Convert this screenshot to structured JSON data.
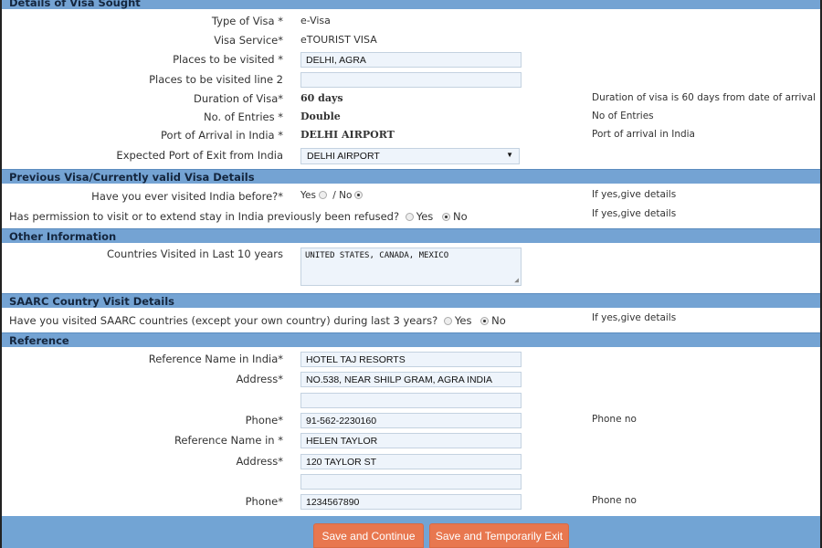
{
  "sections": {
    "visa": "Details of Visa Sought",
    "previous": "Previous Visa/Currently valid Visa Details",
    "other": "Other Information",
    "saarc": "SAARC Country Visit Details",
    "reference": "Reference"
  },
  "visa": {
    "type_label": "Type of Visa *",
    "type_value": "e-Visa",
    "service_label": "Visa Service*",
    "service_value": "eTOURIST VISA",
    "places_label": "Places to be visited *",
    "places_value": "DELHI, AGRA",
    "places2_label": "Places to be visited line 2",
    "places2_value": "",
    "duration_label": "Duration of Visa*",
    "duration_value": "60 days",
    "duration_hint": "Duration of visa is 60 days from date of arrival",
    "entries_label": "No. of Entries *",
    "entries_value": "Double",
    "entries_hint": "No of Entries",
    "arrival_label": "Port of Arrival in India *",
    "arrival_value": "DELHI AIRPORT",
    "arrival_hint": "Port of arrival in India",
    "exit_label": "Expected Port of Exit from India",
    "exit_value": "DELHI AIRPORT"
  },
  "previous": {
    "visited_label": "Have you ever visited India before?*",
    "yes": "Yes",
    "sep": "/ No",
    "visited_selected": "No",
    "visited_hint": "If yes,give details",
    "refused_label": "Has permission to visit or to extend stay in India previously been refused?",
    "refused_yes": "Yes",
    "refused_no": "No",
    "refused_selected": "No",
    "refused_hint": "If yes,give details"
  },
  "other": {
    "countries_label": "Countries Visited in Last 10 years",
    "countries_value": "UNITED STATES, CANADA, MEXICO"
  },
  "saarc": {
    "label": "Have you visited SAARC countries (except your own country) during last 3 years?",
    "yes": "Yes",
    "no": "No",
    "selected": "No",
    "hint": "If yes,give details"
  },
  "reference": {
    "name_india_label": "Reference Name in India*",
    "name_india_value": "HOTEL TAJ RESORTS",
    "address_india_label": "Address*",
    "address_india_value": "NO.538, NEAR SHILP GRAM, AGRA INDIA",
    "address_india_line2": "",
    "phone_india_label": "Phone*",
    "phone_india_value": "91-562-2230160",
    "phone_india_hint": "Phone no",
    "name_home_label": "Reference Name in *",
    "name_home_value": "HELEN TAYLOR",
    "address_home_label": "Address*",
    "address_home_value": "120 TAYLOR ST",
    "address_home_line2": "",
    "phone_home_label": "Phone*",
    "phone_home_value": "1234567890",
    "phone_home_hint": "Phone no"
  },
  "buttons": {
    "save_continue": "Save and Continue",
    "save_exit": "Save and Temporarily Exit"
  },
  "colors": {
    "section_header": "#74a3d3",
    "button": "#e8774f",
    "input_bg": "#eef4fb"
  }
}
